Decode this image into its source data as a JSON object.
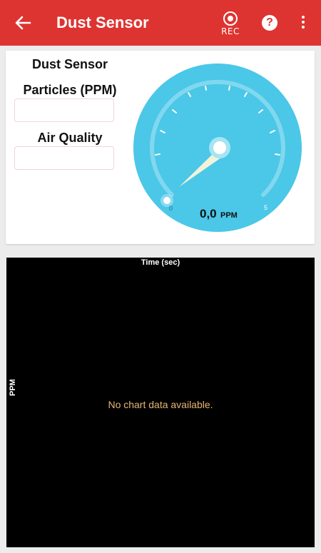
{
  "appbar": {
    "title": "Dust Sensor",
    "rec_label": "REC",
    "help_label": "?",
    "icons": [
      "arrow-back-icon",
      "record-icon",
      "help-icon",
      "more-vert-icon"
    ],
    "color": "#de3431"
  },
  "sensor_card": {
    "heading": "Dust Sensor",
    "particles_label": "Particles (PPM)",
    "particles_value": "",
    "air_quality_label": "Air Quality",
    "air_quality_value": ""
  },
  "gauge": {
    "min_label": "0",
    "max_label": "5",
    "value": "0,0",
    "unit": "PPM",
    "color": "#4bc7e8"
  },
  "chart": {
    "title": "Time (sec)",
    "ylabel": "PPM",
    "empty_message": "No chart data available."
  }
}
